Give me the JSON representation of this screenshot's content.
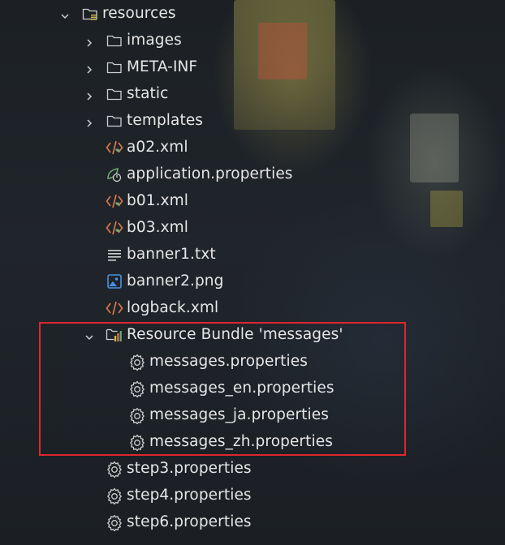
{
  "tree": {
    "items": [
      {
        "label": "resources",
        "icon": "resources-folder-icon",
        "expanded": true
      },
      {
        "label": "images",
        "icon": "folder-icon",
        "expanded": false
      },
      {
        "label": "META-INF",
        "icon": "folder-icon",
        "expanded": false
      },
      {
        "label": "static",
        "icon": "folder-icon",
        "expanded": false
      },
      {
        "label": "templates",
        "icon": "folder-icon",
        "expanded": false
      },
      {
        "label": "a02.xml",
        "icon": "xml-file-icon"
      },
      {
        "label": "application.properties",
        "icon": "spring-properties-icon"
      },
      {
        "label": "b01.xml",
        "icon": "xml-file-icon"
      },
      {
        "label": "b03.xml",
        "icon": "xml-file-icon"
      },
      {
        "label": "banner1.txt",
        "icon": "text-file-icon"
      },
      {
        "label": "banner2.png",
        "icon": "image-file-icon"
      },
      {
        "label": "logback.xml",
        "icon": "xml-file-icon"
      },
      {
        "label": "Resource Bundle 'messages'",
        "icon": "resource-bundle-icon",
        "expanded": true
      },
      {
        "label": "messages.properties",
        "icon": "gear-icon"
      },
      {
        "label": "messages_en.properties",
        "icon": "gear-icon"
      },
      {
        "label": "messages_ja.properties",
        "icon": "gear-icon"
      },
      {
        "label": "messages_zh.properties",
        "icon": "gear-icon"
      },
      {
        "label": "step3.properties",
        "icon": "gear-icon"
      },
      {
        "label": "step4.properties",
        "icon": "gear-icon"
      },
      {
        "label": "step6.properties",
        "icon": "gear-icon"
      }
    ]
  },
  "colors": {
    "highlight_border": "#e0262e",
    "xml_icon": "#e07a4a",
    "image_icon": "#4a8fe0",
    "spring_icon": "#6aab73",
    "text": "#e6e6e6"
  }
}
